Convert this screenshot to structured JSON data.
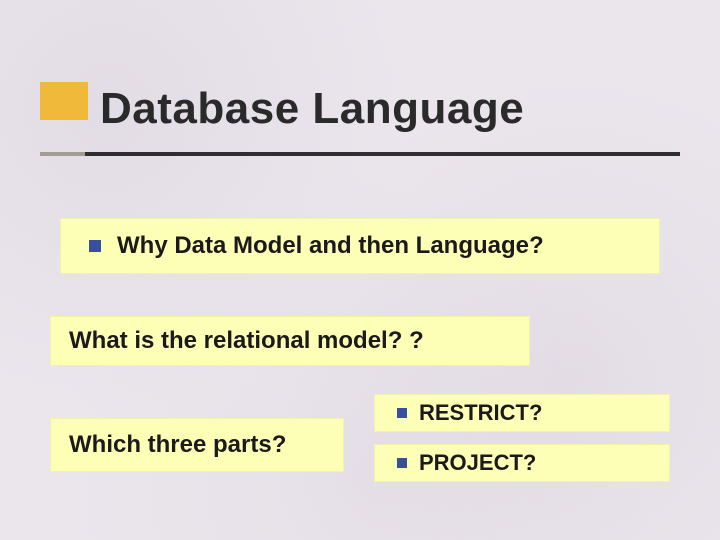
{
  "title": "Database Language",
  "items": {
    "q1": "Why Data Model and then Language?",
    "q2": "What is the relational model? ?",
    "q3": "Which three parts?",
    "q4": "RESTRICT?",
    "q5": "PROJECT?"
  },
  "colors": {
    "accent_block": "#f0b93a",
    "bullet": "#3a4ea0",
    "highlight_bg": "#feffb7"
  }
}
